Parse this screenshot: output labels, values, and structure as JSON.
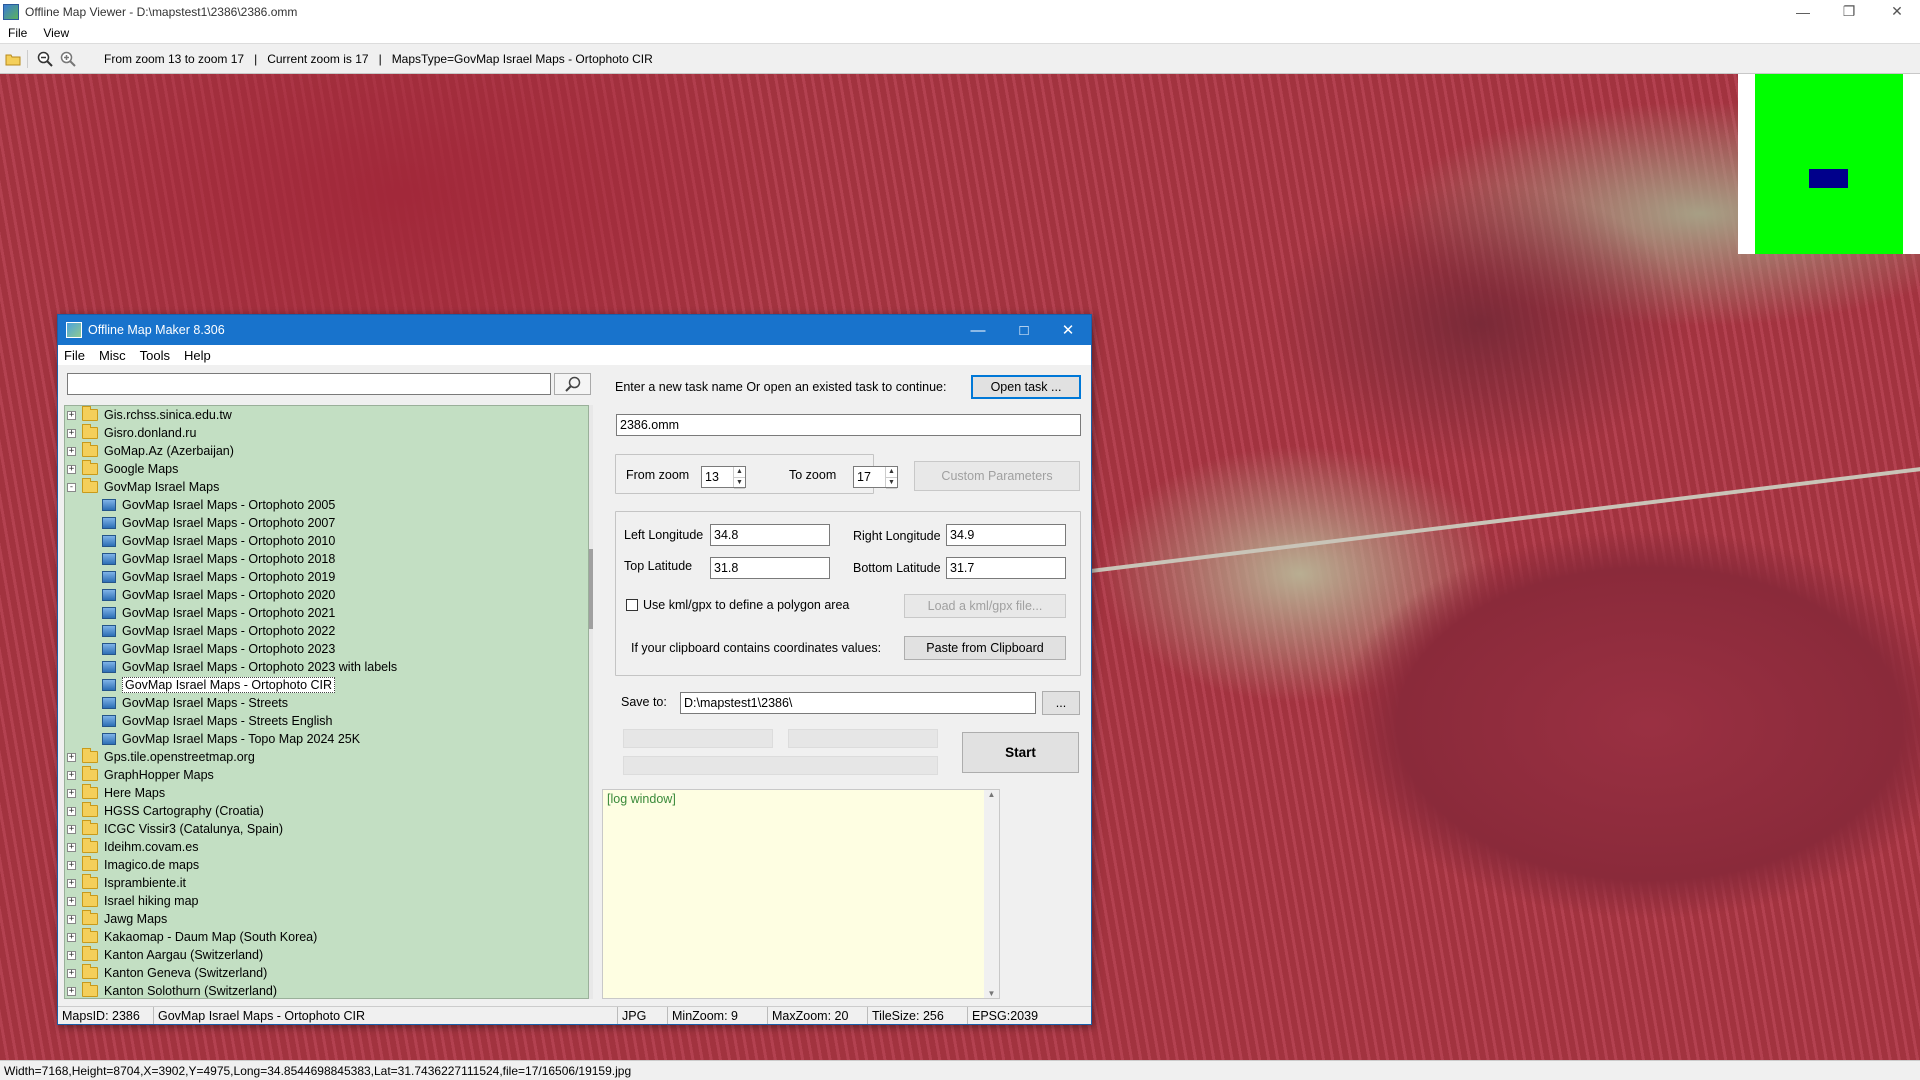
{
  "outer": {
    "title": "Offline Map Viewer - D:\\mapstest1\\2386\\2386.omm",
    "menu": [
      "File",
      "View"
    ],
    "toolbar_info": {
      "zoom_range": "From zoom 13 to zoom 17",
      "current_zoom": "Current zoom is 17",
      "maps_type": "MapsType=GovMap Israel Maps - Ortophoto CIR",
      "sep": "|"
    },
    "status": "Width=7168,Height=8704,X=3902,Y=4975,Long=34.8544698845383,Lat=31.7436227111524,file=17/16506/19159.jpg"
  },
  "dialog": {
    "title": "Offline Map Maker 8.306",
    "menu": [
      "File",
      "Misc",
      "Tools",
      "Help"
    ],
    "search": {
      "value": "",
      "icon": "search-icon"
    },
    "tree": [
      {
        "label": "Gis.rchss.sinica.edu.tw",
        "type": "folder",
        "exp": "+"
      },
      {
        "label": "Gisro.donland.ru",
        "type": "folder",
        "exp": "+"
      },
      {
        "label": "GoMap.Az (Azerbaijan)",
        "type": "folder",
        "exp": "+"
      },
      {
        "label": "Google Maps",
        "type": "folder",
        "exp": "+"
      },
      {
        "label": "GovMap Israel Maps",
        "type": "folder",
        "exp": "-"
      },
      {
        "label": "GovMap Israel Maps - Ortophoto 2005",
        "type": "map"
      },
      {
        "label": "GovMap Israel Maps - Ortophoto 2007",
        "type": "map"
      },
      {
        "label": "GovMap Israel Maps - Ortophoto 2010",
        "type": "map"
      },
      {
        "label": "GovMap Israel Maps - Ortophoto 2018",
        "type": "map"
      },
      {
        "label": "GovMap Israel Maps - Ortophoto 2019",
        "type": "map"
      },
      {
        "label": "GovMap Israel Maps - Ortophoto 2020",
        "type": "map"
      },
      {
        "label": "GovMap Israel Maps - Ortophoto 2021",
        "type": "map"
      },
      {
        "label": "GovMap Israel Maps - Ortophoto 2022",
        "type": "map"
      },
      {
        "label": "GovMap Israel Maps - Ortophoto 2023",
        "type": "map"
      },
      {
        "label": "GovMap Israel Maps - Ortophoto 2023 with labels",
        "type": "map"
      },
      {
        "label": "GovMap Israel Maps - Ortophoto CIR",
        "type": "map",
        "selected": true
      },
      {
        "label": "GovMap Israel Maps - Streets",
        "type": "map"
      },
      {
        "label": "GovMap Israel Maps - Streets English",
        "type": "map"
      },
      {
        "label": "GovMap Israel Maps - Topo Map 2024 25K",
        "type": "map"
      },
      {
        "label": "Gps.tile.openstreetmap.org",
        "type": "folder",
        "exp": "+"
      },
      {
        "label": "GraphHopper Maps",
        "type": "folder",
        "exp": "+"
      },
      {
        "label": "Here Maps",
        "type": "folder",
        "exp": "+"
      },
      {
        "label": "HGSS Cartography (Croatia)",
        "type": "folder",
        "exp": "+"
      },
      {
        "label": "ICGC Vissir3 (Catalunya, Spain)",
        "type": "folder",
        "exp": "+"
      },
      {
        "label": "Ideihm.covam.es",
        "type": "folder",
        "exp": "+"
      },
      {
        "label": "Imagico.de maps",
        "type": "folder",
        "exp": "+"
      },
      {
        "label": "Isprambiente.it",
        "type": "folder",
        "exp": "+"
      },
      {
        "label": "Israel hiking map",
        "type": "folder",
        "exp": "+"
      },
      {
        "label": "Jawg Maps",
        "type": "folder",
        "exp": "+"
      },
      {
        "label": "Kakaomap - Daum Map (South Korea)",
        "type": "folder",
        "exp": "+"
      },
      {
        "label": "Kanton Aargau (Switzerland)",
        "type": "folder",
        "exp": "+"
      },
      {
        "label": "Kanton Geneva (Switzerland)",
        "type": "folder",
        "exp": "+"
      },
      {
        "label": "Kanton Solothurn (Switzerland)",
        "type": "folder",
        "exp": "+"
      }
    ],
    "task": {
      "prompt": "Enter a new task name Or open an existed task to continue:",
      "open_btn": "Open task ...",
      "name": "2386.omm"
    },
    "zoom": {
      "from_label": "From zoom",
      "from_value": "13",
      "to_label": "To zoom",
      "to_value": "17",
      "custom_btn": "Custom Parameters"
    },
    "coords": {
      "left_lon_label": "Left Longitude",
      "left_lon": "34.8",
      "right_lon_label": "Right Longitude",
      "right_lon": "34.9",
      "top_lat_label": "Top Latitude",
      "top_lat": "31.8",
      "bottom_lat_label": "Bottom Latitude",
      "bottom_lat": "31.7",
      "kml_label": "Use kml/gpx to define a polygon area",
      "kml_btn": "Load a kml/gpx file...",
      "clip_label": "If your clipboard contains coordinates values:",
      "clip_btn": "Paste from Clipboard"
    },
    "save": {
      "label": "Save to:",
      "path": "D:\\mapstest1\\2386\\",
      "browse": "...",
      "start": "Start"
    },
    "log": "[log window]",
    "status": {
      "maps_id": "MapsID: 2386",
      "name": "GovMap Israel Maps - Ortophoto CIR",
      "format": "JPG",
      "minzoom": "MinZoom: 9",
      "maxzoom": "MaxZoom: 20",
      "tilesize": "TileSize: 256",
      "epsg": "EPSG:2039"
    }
  },
  "colors": {
    "dialog_title": "#1873cc",
    "tree_bg": "#c3dfc3",
    "log_bg": "#fefee2",
    "minimap": "#00ff00",
    "minimap_view": "#00008b"
  }
}
